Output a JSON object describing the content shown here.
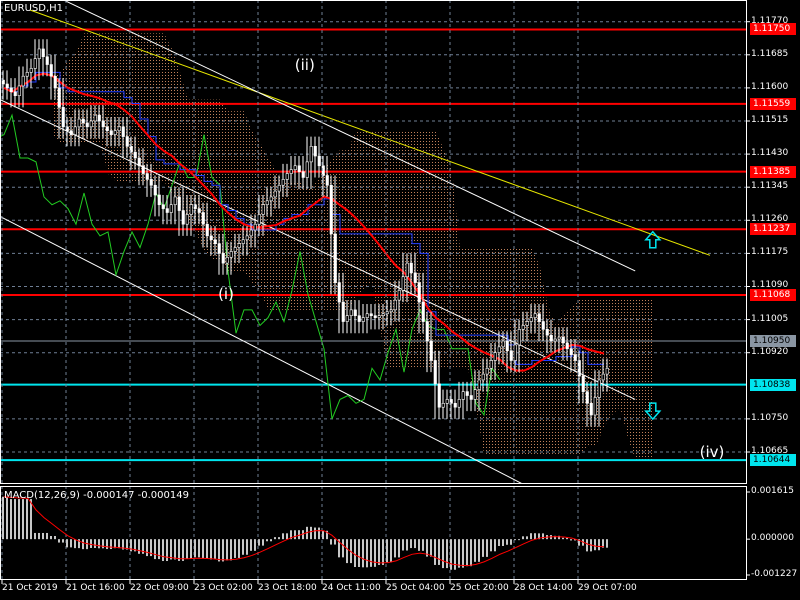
{
  "header": {
    "symbol_label": "EURUSD,H1"
  },
  "macd_label": "MACD(12,26,9) -0.000147 -0.000149",
  "colors": {
    "bg": "#000000",
    "grid": "#6f7f95",
    "level_red": "#ff0000",
    "level_cyan": "#00e5ee",
    "ma": "#ff0000",
    "chikou": "#22cc22",
    "kijun": "#1f3cff",
    "trend_yellow": "#e6e600",
    "trend_white": "#ffffff",
    "cloud_a": "#f0a070",
    "cloud_b": "#d8d8d8"
  },
  "chart_data": {
    "type": "candlestick",
    "title": "EURUSD,H1",
    "price_axis": {
      "min": 1.1054,
      "max": 1.1182,
      "ticks": [
        "1.11770",
        "1.11685",
        "1.11600",
        "1.11515",
        "1.11430",
        "1.11345",
        "1.11260",
        "1.11175",
        "1.11090",
        "1.11005",
        "1.10920",
        "1.10750",
        "1.10665"
      ]
    },
    "time_ticks": [
      "21 Oct 2019",
      "21 Oct 16:00",
      "22 Oct 09:00",
      "23 Oct 02:00",
      "23 Oct 18:00",
      "24 Oct 11:00",
      "25 Oct 04:00",
      "25 Oct 20:00",
      "28 Oct 14:00",
      "29 Oct 07:00"
    ],
    "close": [
      1.116,
      1.1158,
      1.1163,
      1.1165,
      1.117,
      1.1166,
      1.116,
      1.115,
      1.1148,
      1.1152,
      1.115,
      1.1153,
      1.115,
      1.1148,
      1.115,
      1.1145,
      1.1142,
      1.1138,
      1.1135,
      1.113,
      1.1128,
      1.1132,
      1.1125,
      1.113,
      1.1128,
      1.1122,
      1.112,
      1.1115,
      1.1118,
      1.112,
      1.1122,
      1.1125,
      1.113,
      1.1132,
      1.1135,
      1.1138,
      1.114,
      1.1137,
      1.1145,
      1.114,
      1.1135,
      1.111,
      1.11,
      1.1103,
      1.11,
      1.1102,
      1.1101,
      1.1102,
      1.1103,
      1.1108,
      1.1115,
      1.111,
      1.11,
      1.109,
      1.1078,
      1.108,
      1.1078,
      1.1082,
      1.108,
      1.1085,
      1.1088,
      1.1092,
      1.1095,
      1.109,
      1.1098,
      1.11,
      1.1102,
      1.1098,
      1.1095,
      1.1096,
      1.1093,
      1.109,
      1.1082,
      1.1076,
      1.1085,
      1.1088
    ],
    "levels": [
      {
        "price": "1.11750",
        "color": "red"
      },
      {
        "price": "1.11559",
        "color": "red"
      },
      {
        "price": "1.11385",
        "color": "red"
      },
      {
        "price": "1.11237",
        "color": "red"
      },
      {
        "price": "1.11068",
        "color": "red"
      },
      {
        "price": "1.10950",
        "color": "gray"
      },
      {
        "price": "1.10838",
        "color": "cyan"
      },
      {
        "price": "1.10644",
        "color": "cyan"
      }
    ],
    "trendlines": [
      {
        "color": "yellow",
        "from": [
          3.25,
          1.118
        ],
        "to": [
          88.25,
          1.1117
        ]
      },
      {
        "color": "white",
        "from": [
          7,
          1.1183
        ],
        "to": [
          78.9,
          1.1113
        ]
      },
      {
        "color": "white",
        "from": [
          -0.5,
          1.1157
        ],
        "to": [
          78.9,
          1.108
        ]
      },
      {
        "color": "white",
        "from": [
          -0.5,
          1.1127
        ],
        "to": [
          65.1,
          1.1058
        ]
      }
    ],
    "annotations": [
      {
        "text": "(ii)",
        "at": [
          37.6,
          1.1166
        ]
      },
      {
        "text": "(i)",
        "at": [
          27.75,
          1.1107
        ]
      },
      {
        "text": "(iv)",
        "at": [
          88.5,
          1.10665
        ]
      }
    ],
    "arrows": [
      {
        "dir": "up",
        "at": [
          81.1,
          1.1121
        ]
      },
      {
        "dir": "down",
        "at": [
          81.1,
          1.1077
        ]
      }
    ],
    "macd": {
      "params": "12,26,9",
      "value": "-0.000147",
      "signal": "-0.000149",
      "ticks": [
        "0.001615",
        "0.000000",
        "-0.001227"
      ],
      "min": -0.001227,
      "max": 0.001615
    }
  }
}
